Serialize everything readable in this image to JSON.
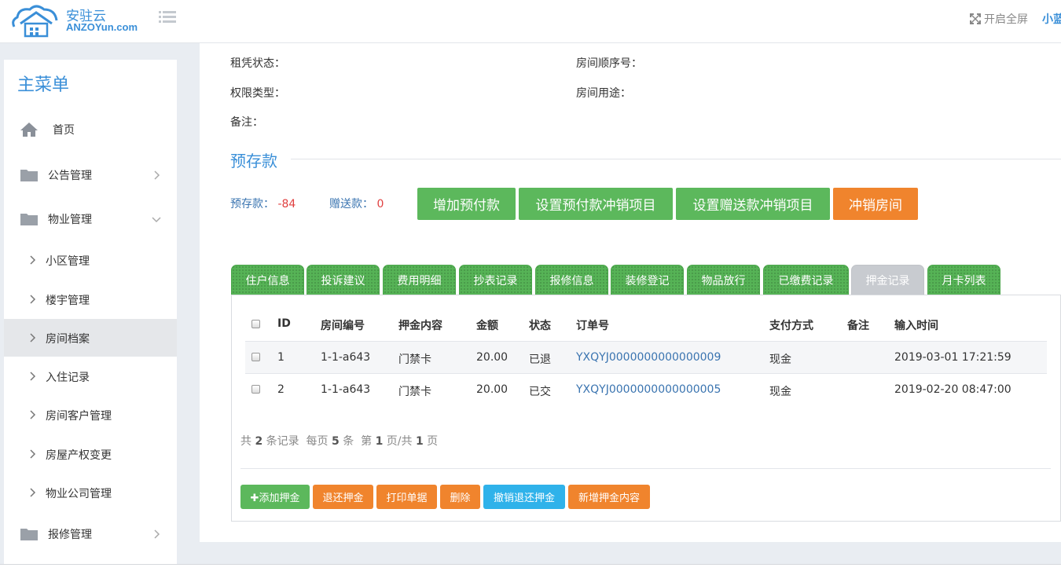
{
  "header": {
    "logo_cn": "安驻云",
    "logo_en": "ANZOYun.com",
    "fullscreen_label": "开启全屏",
    "user_label": "小蓝"
  },
  "sidebar": {
    "title": "主菜单",
    "items": [
      {
        "label": "首页",
        "icon": "home-icon"
      },
      {
        "label": "公告管理",
        "icon": "folder-icon",
        "chevron": "right"
      },
      {
        "label": "物业管理",
        "icon": "folder-icon",
        "chevron": "down"
      }
    ],
    "sub_items": [
      {
        "label": "小区管理"
      },
      {
        "label": "楼宇管理"
      },
      {
        "label": "房间档案",
        "active": true
      },
      {
        "label": "入住记录"
      },
      {
        "label": "房间客户管理"
      },
      {
        "label": "房屋产权变更"
      },
      {
        "label": "物业公司管理"
      }
    ],
    "bottom_item": {
      "label": "报修管理",
      "icon": "folder-icon",
      "chevron": "right"
    }
  },
  "info": {
    "rent_status": "租凭状态：",
    "room_order": "房间顺序号：",
    "permission_type": "权限类型：",
    "room_use": "房间用途：",
    "remark": "备注："
  },
  "prepaid": {
    "section_title": "预存款",
    "balance_label": "预存款：",
    "balance_value": "-84",
    "gift_label": "赠送款：",
    "gift_value": "0",
    "buttons": [
      "增加预付款",
      "设置预付款冲销项目",
      "设置赠送款冲销项目",
      "冲销房间"
    ]
  },
  "tabs": [
    "住户信息",
    "投诉建议",
    "费用明细",
    "抄表记录",
    "报修信息",
    "装修登记",
    "物品放行",
    "已缴费记录",
    "押金记录",
    "月卡列表"
  ],
  "table": {
    "headers": [
      "ID",
      "房间编号",
      "押金内容",
      "金额",
      "状态",
      "订单号",
      "支付方式",
      "备注",
      "输入时间"
    ],
    "rows": [
      [
        "1",
        "1-1-a643",
        "门禁卡",
        "20.00",
        "已退",
        "YXQYJ0000000000000009",
        "现金",
        "",
        "2019-03-01 17:21:59"
      ],
      [
        "2",
        "1-1-a643",
        "门禁卡",
        "20.00",
        "已交",
        "YXQYJ0000000000000005",
        "现金",
        "",
        "2019-02-20 08:47:00"
      ]
    ]
  },
  "pager": {
    "p1": "共",
    "total": "2",
    "p2": "条记录  每页",
    "per_page": "5",
    "p3": "条  第",
    "page": "1",
    "p4": "页/共",
    "pages": "1",
    "p5": "页"
  },
  "actions": [
    "✚添加押金",
    "退还押金",
    "打印单据",
    "删除",
    "撤销退还押金",
    "新增押金内容"
  ],
  "colors": {
    "accent": "#3a8fd8",
    "green": "#5cb85c",
    "orange": "#f0842d",
    "blue": "#2fb2ea"
  }
}
